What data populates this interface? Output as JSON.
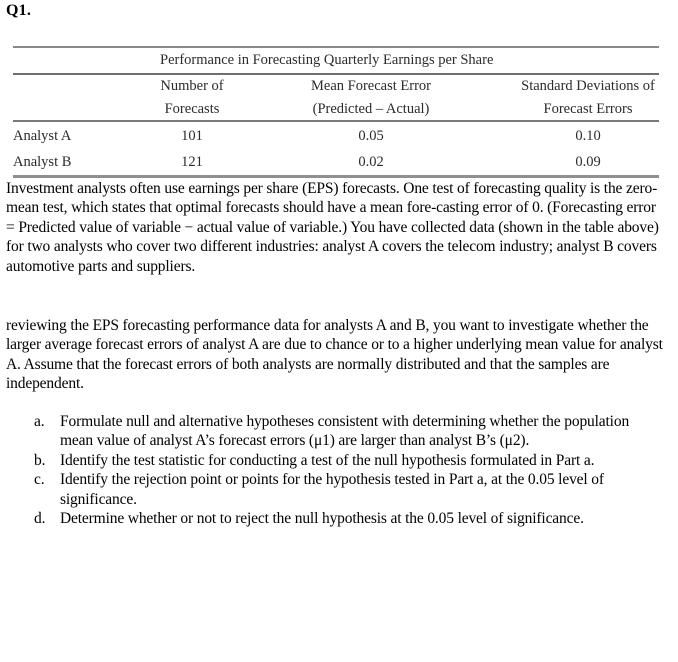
{
  "question_label": "Q1.",
  "table": {
    "title": "Performance in Forecasting Quarterly Earnings per Share",
    "columns": [
      {
        "line1": "Number of",
        "line2": "Forecasts"
      },
      {
        "line1": "Mean Forecast Error",
        "line2": "(Predicted – Actual)"
      },
      {
        "line1": "Standard Deviations of",
        "line2": "Forecast Errors"
      }
    ],
    "rows": [
      {
        "label": "Analyst A",
        "forecasts": "101",
        "mean_error": "0.05",
        "std_dev": "0.10"
      },
      {
        "label": "Analyst B",
        "forecasts": "121",
        "mean_error": "0.02",
        "std_dev": "0.09"
      }
    ]
  },
  "paragraph1": "Investment analysts often use earnings per share (EPS) forecasts. One test of forecasting quality is the zero-mean test, which states that optimal forecasts should have a mean fore-casting error of 0. (Forecasting error = Predicted value of variable − actual value of variable.) You have collected data (shown in the table above) for two analysts who cover two different industries: analyst A covers the telecom industry; analyst B covers automotive parts and suppliers.",
  "paragraph2": "reviewing the EPS forecasting performance data for analysts A and B, you want to investigate whether the larger average forecast errors of analyst A are due to chance or to a higher underlying mean value for analyst A. Assume that the forecast errors of both analysts are normally distributed and that the samples are independent.",
  "tasks": [
    {
      "marker": "a.",
      "text": "Formulate null and alternative hypotheses consistent with determining whether the population mean value of analyst A’s forecast errors (μ1) are larger than analyst B’s (μ2)."
    },
    {
      "marker": "b.",
      "text": "Identify the test statistic for conducting a test of the null hypothesis formulated in Part a."
    },
    {
      "marker": "c.",
      "text": "Identify the rejection point or points for the hypothesis tested in Part a, at the 0.05 level of significance."
    },
    {
      "marker": "d.",
      "text": "Determine whether or not to reject the null hypothesis at the 0.05 level of significance."
    }
  ]
}
